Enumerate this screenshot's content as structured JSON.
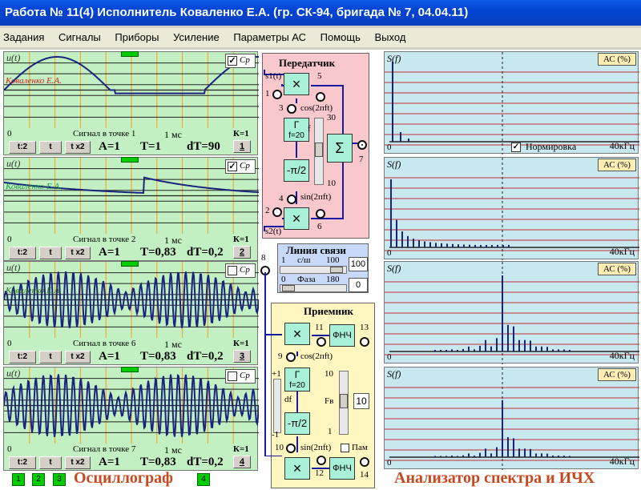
{
  "window": {
    "title": "Работа № 11(4)  Исполнитель Коваленко Е.А. (гр. СК-94, бригада № 7, 04.04.11)"
  },
  "menu": [
    "Задания",
    "Сигналы",
    "Приборы",
    "Усиление",
    "Параметры АС",
    "Помощь",
    "Выход"
  ],
  "colors": {
    "osc_bg": "#c2f0c2",
    "spec_bg": "#c8e8f0",
    "trace": "#1a237e",
    "tx_bg": "#f8c8cc",
    "rx_bg": "#fff6c0"
  },
  "oscilloscopes": [
    {
      "ylabel": "u(t)",
      "name": "Коваленко Е.А.",
      "cp_checked": true,
      "cp": "Ср",
      "zero": "0",
      "caption": "Сигнал в точке 1",
      "time": "1 мс",
      "k": "К=1",
      "t2": "t:2",
      "t": "t",
      "tx2": "t x2",
      "a": "A=1",
      "T": "T=1",
      "dT": "dT=90",
      "btn": "1"
    },
    {
      "ylabel": "u(t)",
      "name": "Коваленко Е.А.",
      "cp_checked": true,
      "cp": "Ср",
      "zero": "0",
      "caption": "Сигнал в точке 2",
      "time": "1 мс",
      "k": "К=1",
      "t2": "t:2",
      "t": "t",
      "tx2": "t x2",
      "a": "A=1",
      "T": "T=0,83",
      "dT": "dT=0,2",
      "btn": "2"
    },
    {
      "ylabel": "u(t)",
      "name": "Коваленко Е.А.",
      "cp_checked": false,
      "cp": "Ср",
      "zero": "0",
      "caption": "Сигнал в точке 6",
      "time": "1 мс",
      "k": "К=1",
      "t2": "t:2",
      "t": "t",
      "tx2": "t x2",
      "a": "A=1",
      "T": "T=0,83",
      "dT": "dT=0,2",
      "btn": "3"
    },
    {
      "ylabel": "u(t)",
      "name": "",
      "cp_checked": false,
      "cp": "Ср",
      "zero": "0",
      "caption": "Сигнал в точке 7",
      "time": "1 мс",
      "k": "К=1",
      "t2": "t:2",
      "t": "t",
      "tx2": "t x2",
      "a": "A=1",
      "T": "T=0,83",
      "dT": "dT=0,2",
      "btn": "4"
    }
  ],
  "bottom": {
    "buttons": [
      "1",
      "2",
      "3",
      "4"
    ],
    "osc_title": "Осциллограф",
    "spec_title": "Анализатор спектра и ИЧХ"
  },
  "transmitter": {
    "title": "Передатчик",
    "s1": "s1(t)",
    "s2": "s2(t)",
    "n1": "1",
    "n2": "2",
    "n3": "3",
    "n4": "4",
    "n5": "5",
    "n6": "6",
    "n7": "7",
    "cos": "cos(2пft)",
    "sin": "sin(2пft)",
    "gen": "Г",
    "genf": "f=20",
    "f": "f",
    "v30": "30",
    "v10": "10",
    "phase": "-π/2",
    "sum": "Σ",
    "mul": "×"
  },
  "line": {
    "title": "Линия связи",
    "sn_min": "1",
    "sn_label": "с/ш",
    "sn_max": "100",
    "sn_value": "100",
    "ph_min": "0",
    "ph_label": "Фаза",
    "ph_max": "180",
    "ph_value": "0",
    "n8": "8"
  },
  "receiver": {
    "title": "Приемник",
    "n9": "9",
    "n10": "10",
    "n11": "11",
    "n12": "12",
    "n13": "13",
    "n14": "14",
    "cos": "cos(2пft)",
    "sin": "sin(2пft)",
    "gen": "Г",
    "genf": "f=20",
    "df": "df",
    "plus1": "+1",
    "minus1": "-1",
    "v10": "10",
    "v1": "1",
    "fv": "Fв",
    "fv_value": "10",
    "pam": "Пам",
    "lpf": "ФНЧ",
    "phase": "-π/2",
    "mul": "×"
  },
  "spectra": [
    {
      "ylabel": "S(f)",
      "ac": "АС (%)",
      "zero": "0",
      "fmax": "40кГц",
      "norm_label": "Нормировка",
      "norm_checked": true
    },
    {
      "ylabel": "S(f)",
      "ac": "АС (%)",
      "zero": "0",
      "fmax": "40кГц"
    },
    {
      "ylabel": "S(f)",
      "ac": "АС (%)",
      "zero": "0",
      "fmax": "40кГц"
    },
    {
      "ylabel": "S(f)",
      "ac": "АС (%)",
      "zero": "0",
      "fmax": "40кГц"
    }
  ]
}
